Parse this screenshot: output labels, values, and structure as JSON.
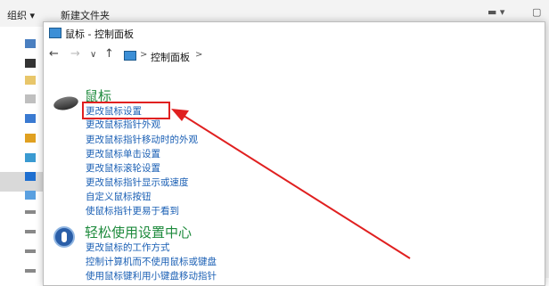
{
  "explorer": {
    "toolbar": {
      "organize": "组织 ▾",
      "new_folder": "新建文件夹"
    }
  },
  "window": {
    "title": "鼠标 - 控制面板"
  },
  "address": {
    "back": "←",
    "forward": "→",
    "recent": "∨",
    "up": "↑",
    "separator": ">",
    "path": "控制面板",
    "trail_separator": ">"
  },
  "sections": [
    {
      "heading": "鼠标",
      "icon": "mouse-icon",
      "links": [
        "更改鼠标设置",
        "更改鼠标指针外观",
        "更改鼠标指针移动时的外观",
        "更改鼠标单击设置",
        "更改鼠标滚轮设置",
        "更改鼠标指针显示或速度",
        "自定义鼠标按钮",
        "使鼠标指针更易于看到"
      ]
    },
    {
      "heading": "轻松使用设置中心",
      "icon": "ease-of-access-icon",
      "links": [
        "更改鼠标的工作方式",
        "控制计算机而不使用鼠标或键盘",
        "使用鼠标键利用小键盘移动指针"
      ]
    }
  ],
  "annotation": {
    "color": "#e02020",
    "highlighted_link": "更改鼠标设置"
  },
  "colors": {
    "heading": "#1d8a3c",
    "link": "#1a5fb4"
  }
}
